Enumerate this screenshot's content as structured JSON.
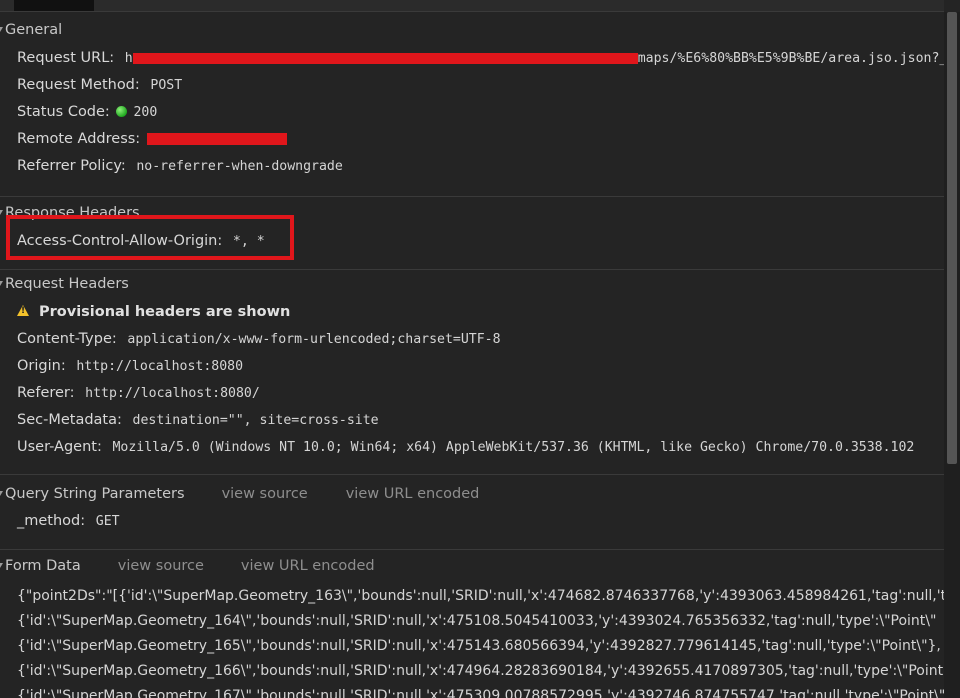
{
  "general": {
    "title": "General",
    "request_url": {
      "key": "Request URL:",
      "prefix": "h",
      "suffix": "maps/%E6%80%BB%E5%9B%BE/area.jso.json?_"
    },
    "request_method": {
      "key": "Request Method:",
      "value": "POST"
    },
    "status_code": {
      "key": "Status Code:",
      "value": "200"
    },
    "remote_address": {
      "key": "Remote Address:"
    },
    "referrer_policy": {
      "key": "Referrer Policy:",
      "value": "no-referrer-when-downgrade"
    }
  },
  "response_headers": {
    "title": "Response Headers",
    "items": [
      {
        "key": "Access-Control-Allow-Origin:",
        "value": "*, *"
      }
    ]
  },
  "request_headers": {
    "title": "Request Headers",
    "warning": "Provisional headers are shown",
    "items": [
      {
        "key": "Content-Type:",
        "value": "application/x-www-form-urlencoded;charset=UTF-8"
      },
      {
        "key": "Origin:",
        "value": "http://localhost:8080"
      },
      {
        "key": "Referer:",
        "value": "http://localhost:8080/"
      },
      {
        "key": "Sec-Metadata:",
        "value": "destination=\"\", site=cross-site"
      },
      {
        "key": "User-Agent:",
        "value": "Mozilla/5.0 (Windows NT 10.0; Win64; x64) AppleWebKit/537.36 (KHTML, like Gecko) Chrome/70.0.3538.102"
      }
    ]
  },
  "query_params": {
    "title": "Query String Parameters",
    "view_source": "view source",
    "view_url_encoded": "view URL encoded",
    "items": [
      {
        "key": "_method:",
        "value": "GET"
      }
    ]
  },
  "form_data": {
    "title": "Form Data",
    "view_source": "view source",
    "view_url_encoded": "view URL encoded",
    "lines": [
      "{\"point2Ds\":\"[{'id':\\\"SuperMap.Geometry_163\\\",'bounds':null,'SRID':null,'x':474682.8746337768,'y':4393063.458984261,'tag':null,'t",
      "{'id':\\\"SuperMap.Geometry_164\\\",'bounds':null,'SRID':null,'x':475108.5045410033,'y':4393024.765356332,'tag':null,'type':\\\"Point\\\"",
      "{'id':\\\"SuperMap.Geometry_165\\\",'bounds':null,'SRID':null,'x':475143.680566394,'y':4392827.779614145,'tag':null,'type':\\\"Point\\\"},",
      "{'id':\\\"SuperMap.Geometry_166\\\",'bounds':null,'SRID':null,'x':474964.28283690184,'y':4392655.4170897305,'tag':null,'type':\\\"Point",
      "{'id':\\\"SuperMap.Geometry_167\\\",'bounds':null,'SRID':null,'x':475309.00788572995,'y':4392746.874755747,'tag':null,'type':\\\"Point\\\""
    ]
  },
  "colors": {
    "redaction": "#e0161b",
    "status_ok": "#1fa81f",
    "warning": "#f4c22b"
  }
}
